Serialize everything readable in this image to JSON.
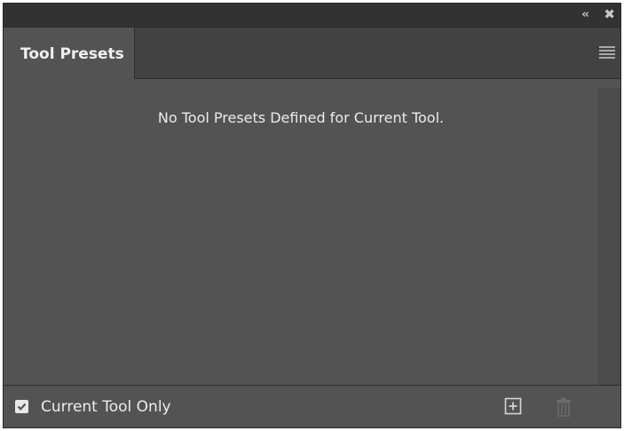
{
  "panel": {
    "title_icons": {
      "collapse": "double-chevron-left-icon",
      "close": "close-icon"
    },
    "tab_label": "Tool Presets",
    "menu_icon": "hamburger-menu-icon"
  },
  "content": {
    "empty_message": "No Tool Presets Defined for Current Tool."
  },
  "footer": {
    "checkbox_label": "Current Tool Only",
    "checkbox_checked": true,
    "new_icon": "new-preset-icon",
    "delete_icon": "trash-icon"
  },
  "colors": {
    "panel_bg": "#535353",
    "titlebar_bg": "#323232",
    "tabbar_bg": "#424242",
    "text": "#ececec"
  }
}
